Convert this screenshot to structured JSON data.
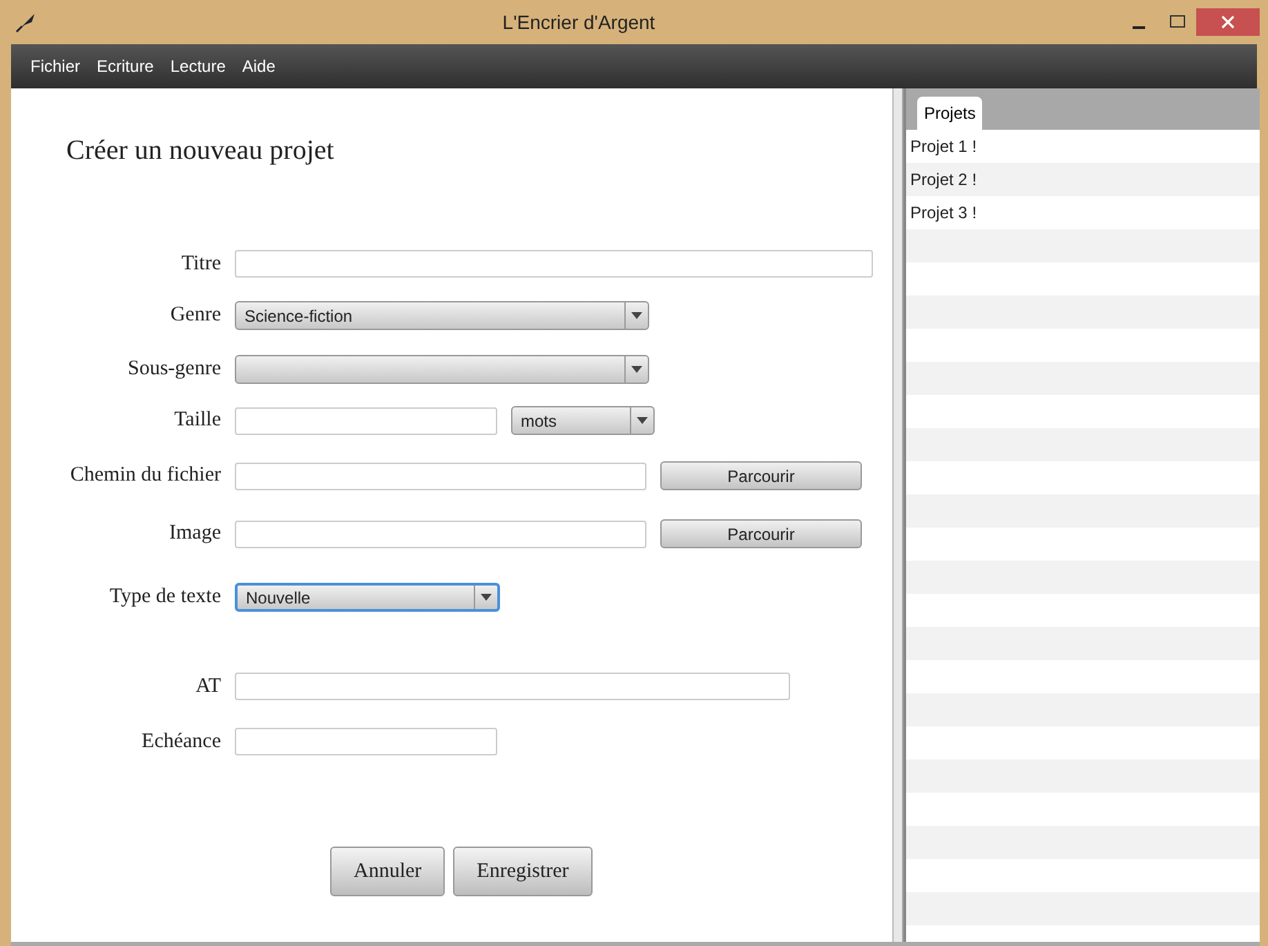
{
  "window": {
    "title": "L'Encrier d'Argent"
  },
  "menu": [
    "Fichier",
    "Ecriture",
    "Lecture",
    "Aide"
  ],
  "form": {
    "title": "Créer un nouveau projet",
    "fields": [
      {
        "label": "Titre",
        "kind": "text"
      },
      {
        "label": "Genre",
        "kind": "combo",
        "value": "Science-fiction",
        "focused": false
      },
      {
        "label": "Sous-genre",
        "kind": "combo",
        "focused": false
      },
      {
        "label": "Taille",
        "kind": "text-combo",
        "value": "mots",
        "focused": false
      },
      {
        "label": "Chemin du fichier",
        "kind": "text-button",
        "button": "Parcourir"
      },
      {
        "label": "Image",
        "kind": "text-button",
        "button": "Parcourir"
      },
      {
        "label": "Type de texte",
        "kind": "combo",
        "value": "Nouvelle",
        "focused": true
      },
      {
        "label": "AT",
        "kind": "text"
      },
      {
        "label": "Echéance",
        "kind": "text"
      }
    ],
    "buttons": [
      "Annuler",
      "Enregistrer"
    ]
  },
  "side": {
    "tabs": [
      {
        "label": "Projets",
        "selected": true
      }
    ],
    "projects": [
      "Projet 1 !",
      "Projet 2 !",
      "Projet 3 !"
    ]
  }
}
